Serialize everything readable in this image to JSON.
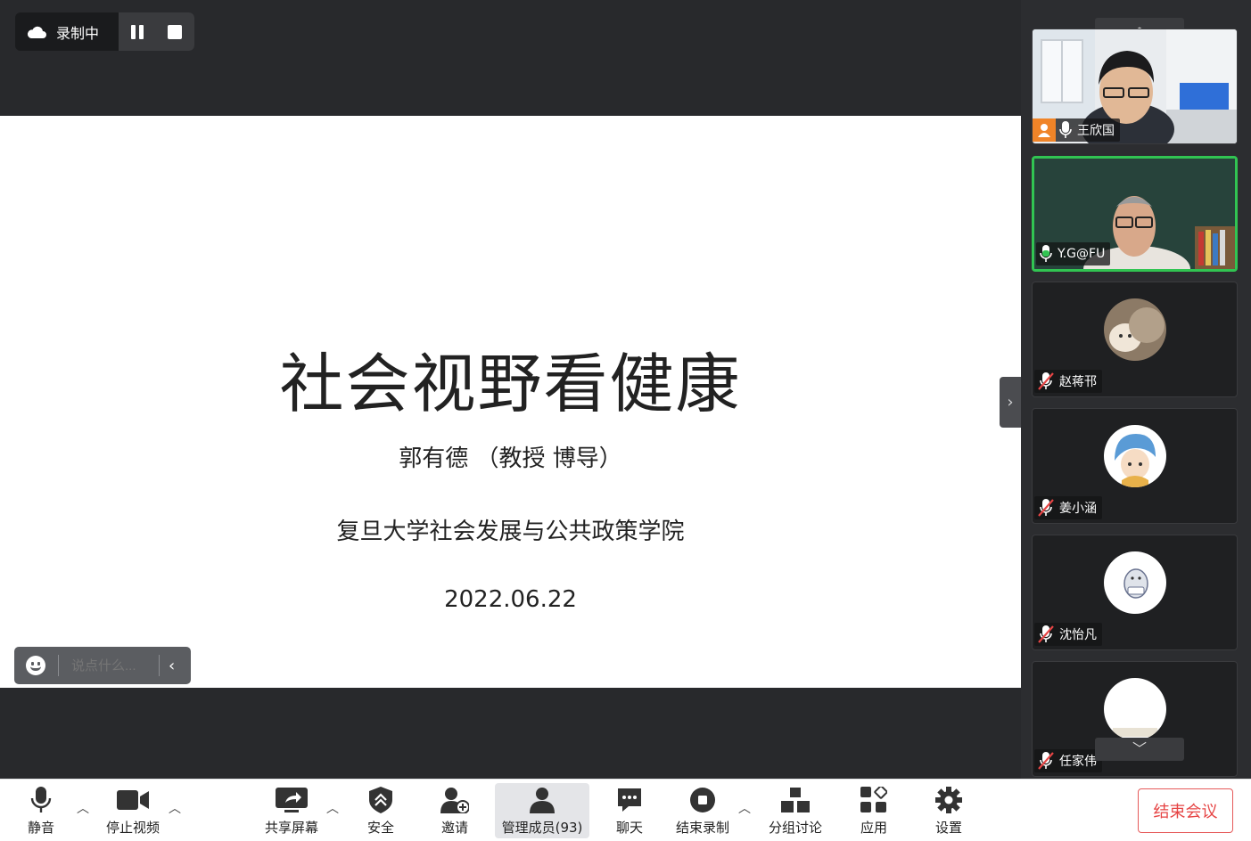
{
  "recording": {
    "label": "录制中"
  },
  "slide": {
    "title": "社会视野看健康",
    "author": "郭有德 （教授 博导）",
    "school": "复旦大学社会发展与公共政策学院",
    "date": "2022.06.22"
  },
  "chat_box": {
    "placeholder": "说点什么..."
  },
  "participants": [
    {
      "name": "王欣国",
      "host": true,
      "muted": false
    },
    {
      "name": "Y.G@FU",
      "host": false,
      "muted": false,
      "speaking": true
    },
    {
      "name": "赵蒋邗",
      "muted": true
    },
    {
      "name": "姜小涵",
      "muted": true
    },
    {
      "name": "沈怡凡",
      "muted": true
    },
    {
      "name": "任家伟",
      "muted": true
    }
  ],
  "toolbar": {
    "mute": "静音",
    "stop_video": "停止视频",
    "share_screen": "共享屏幕",
    "security": "安全",
    "invite": "邀请",
    "manage_members": "管理成员(93)",
    "chat": "聊天",
    "end_recording": "结束录制",
    "breakout": "分组讨论",
    "apps": "应用",
    "settings": "设置",
    "end_meeting": "结束会议"
  },
  "colors": {
    "active_speaker": "#31c452",
    "host_badge": "#f08428",
    "end_meeting": "#e64545"
  }
}
